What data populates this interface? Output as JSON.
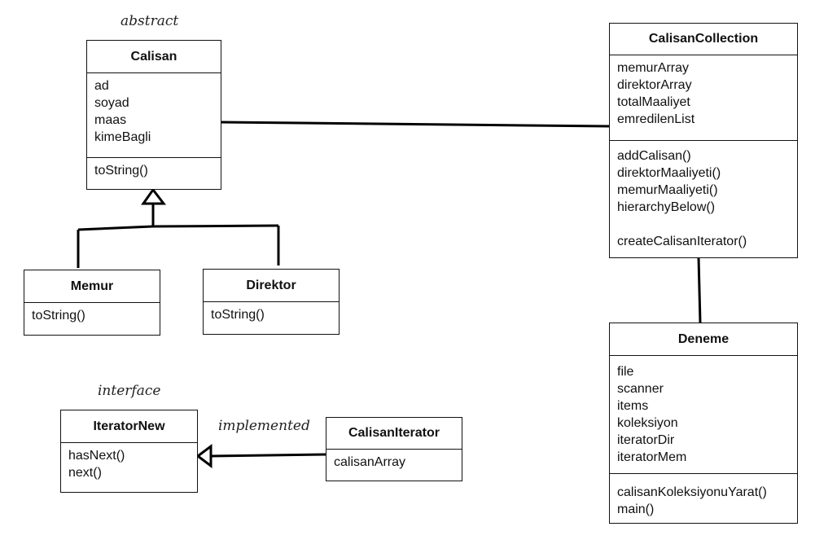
{
  "labels": {
    "abstract": "abstract",
    "interface": "interface",
    "implemented": "implemented"
  },
  "classes": {
    "calisan": {
      "name": "Calisan",
      "attributes": [
        "ad",
        "soyad",
        "maas",
        "kimeBagli"
      ],
      "methods": [
        "toString()"
      ]
    },
    "memur": {
      "name": "Memur",
      "methods": [
        "toString()"
      ]
    },
    "direktor": {
      "name": "Direktor",
      "methods": [
        "toString()"
      ]
    },
    "collection": {
      "name": "CalisanCollection",
      "attributes": [
        "memurArray",
        "direktorArray",
        "totalMaaliyet",
        "emredilenList"
      ],
      "methods": [
        "addCalisan()",
        "direktorMaaliyeti()",
        "memurMaaliyeti()",
        "hierarchyBelow()"
      ],
      "extra_method": "createCalisanIterator()"
    },
    "deneme": {
      "name": "Deneme",
      "attributes": [
        "file",
        "scanner",
        "items",
        "koleksiyon",
        "iteratorDir",
        "iteratorMem"
      ],
      "methods": [
        "calisanKoleksiyonuYarat()",
        "main()"
      ]
    },
    "iteratorNew": {
      "name": "IteratorNew",
      "methods": [
        "hasNext()",
        "next()"
      ]
    },
    "calisanIterator": {
      "name": "CalisanIterator",
      "attributes": [
        "calisanArray"
      ]
    }
  }
}
